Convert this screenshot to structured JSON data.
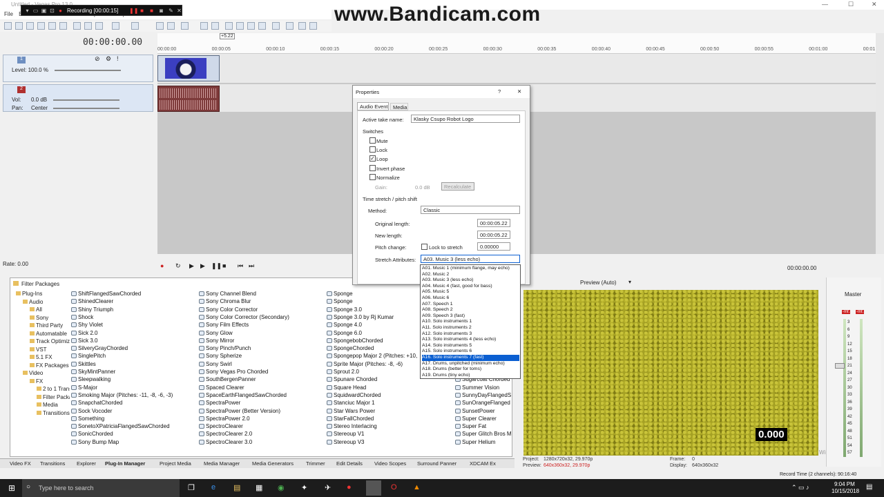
{
  "window": {
    "title": "Untitled - Vegas Pro 13.0",
    "minimize": "—",
    "maximize": "☐",
    "close": "✕"
  },
  "menu": [
    "File",
    "Edit",
    "View",
    "Insert",
    "Tools",
    "Options",
    "Help"
  ],
  "recorder": {
    "status": "Recording [00:00:15]"
  },
  "watermark": "www.Bandicam.com",
  "timeline": {
    "timecode": "00:00:00.00",
    "ruler_marker": "+5.22",
    "ticks": [
      "00:00:00",
      "00:00:05",
      "00:00:10",
      "00:00:15",
      "00:00:20",
      "00:00:25",
      "00:00:30",
      "00:00:35",
      "00:00:40",
      "00:00:45",
      "00:00:50",
      "00:00:55",
      "00:01:00",
      "00:01:05"
    ],
    "rate": "Rate: 0.00",
    "end_time": "00:00:00.00"
  },
  "tracks": {
    "video": {
      "number": "1",
      "level_label": "Level: 100.0 %"
    },
    "audio": {
      "number": "2",
      "vol_label": "Vol:",
      "vol_value": "0.0 dB",
      "pan_label": "Pan:",
      "pan_value": "Center"
    }
  },
  "dialog": {
    "title": "Properties",
    "help": "?",
    "close": "✕",
    "tabs": [
      "Audio Event",
      "Media"
    ],
    "active_take_label": "Active take name:",
    "active_take_value": "Klasky Csupo Robot Logo",
    "switches_label": "Switches",
    "switches": [
      {
        "label": "Mute",
        "checked": false
      },
      {
        "label": "Lock",
        "checked": false
      },
      {
        "label": "Loop",
        "checked": true
      },
      {
        "label": "Invert phase",
        "checked": false
      },
      {
        "label": "Normalize",
        "checked": false
      }
    ],
    "gain_label": "Gain:",
    "gain_value": "0.0 dB",
    "recalc_button": "Recalculate",
    "stretch_section": "Time stretch / pitch shift",
    "method_label": "Method:",
    "method_value": "Classic",
    "original_length_label": "Original length:",
    "original_length_value": "00:00:05.22",
    "new_length_label": "New length:",
    "new_length_value": "00:00:05.22",
    "pitch_change_label": "Pitch change:",
    "lock_to_stretch_label": "Lock to stretch",
    "pitch_value": "0.00000",
    "stretch_attr_label": "Stretch Attributes:",
    "stretch_attr_value": "A03. Music 3 (less echo)",
    "stretch_options": [
      "A01. Music 1 (minimum flange, may echo)",
      "A02. Music 2",
      "A03. Music 3 (less echo)",
      "A04. Music 4 (fast, good for bass)",
      "A05. Music 5",
      "A06. Music 6",
      "A07. Speech 1",
      "A08. Speech 2",
      "A09. Speech 3 (fast)",
      "A10. Solo instruments 1",
      "A11. Solo instruments 2",
      "A12. Solo instruments 3",
      "A13. Solo instruments 4 (less echo)",
      "A14. Solo instruments 5",
      "A15. Solo instruments 6",
      "A16. Solo instruments 7 (fast)",
      "A17. Drums, unpitched (minimum echo)",
      "A18. Drums (better for toms)",
      "A19. Drums (tiny echo)"
    ],
    "highlighted_option": "A16. Solo instruments 7 (fast)"
  },
  "plugin_panel": {
    "header": "Filter Packages",
    "tree": [
      {
        "label": "Plug-Ins",
        "level": 0
      },
      {
        "label": "Audio",
        "level": 1
      },
      {
        "label": "All",
        "level": 2
      },
      {
        "label": "Sony",
        "level": 2
      },
      {
        "label": "Third Party",
        "level": 2
      },
      {
        "label": "Automatable",
        "level": 2
      },
      {
        "label": "Track Optimized",
        "level": 2
      },
      {
        "label": "VST",
        "level": 2
      },
      {
        "label": "5.1 FX",
        "level": 2
      },
      {
        "label": "FX Packages",
        "level": 2
      },
      {
        "label": "Video",
        "level": 1
      },
      {
        "label": "FX",
        "level": 2
      },
      {
        "label": "2 to 1 Transform",
        "level": 3
      },
      {
        "label": "Filter Packages",
        "level": 3
      },
      {
        "label": "Media",
        "level": 3
      },
      {
        "label": "Transitions",
        "level": 3
      }
    ],
    "col1": [
      "ShiftFlangedSawChorded",
      "ShinedClearer",
      "Shiny Triumph",
      "Shock",
      "Shy Violet",
      "Sick 2.0",
      "Sick 3.0",
      "SilveryGrayChorded",
      "SinglePitch",
      "Skittles",
      "SkyMintPanner",
      "Sleepwalking",
      "S-Major",
      "Smoking Major (Pitches: -11, -8, -6, -3)",
      "SnapchatChorded",
      "Sock Vocoder",
      "Something",
      "SonetoXPatriciaFlangedSawChorded",
      "SonicChorded",
      "Sony Bump Map"
    ],
    "col2": [
      "Sony Channel Blend",
      "Sony Chroma Blur",
      "Sony Color Corrector",
      "Sony Color Corrector (Secondary)",
      "Sony Film Effects",
      "Sony Glow",
      "Sony Mirror",
      "Sony Pinch/Punch",
      "Sony Spherize",
      "Sony Swirl",
      "Sony Vegas Pro Chorded",
      "SouthBergenPanner",
      "Spaced Clearer",
      "SpaceEarthFlangedSawChorded",
      "SpectraPower",
      "SpectraPower (Better Version)",
      "SpectraPower 2.0",
      "SpectroClearer",
      "SpectroClearer 2.0",
      "SpectroClearer 3.0"
    ],
    "col3": [
      "Sponge",
      "Sponge",
      "Sponge 3.0",
      "Sponge 3.0 by Rj Kumar",
      "Sponge 4.0",
      "Sponge 6.0",
      "SpongebobChorded",
      "SpongeChorded",
      "Spongepop Major 2 (Pitches: +10,",
      "Sprite Major (Pitches: -8, -6)",
      "Sprout 2.0",
      "Spunare Chorded",
      "Square Head",
      "SquidwardChorded",
      "Stanciuc Major 1",
      "Star Wars Power",
      "StarFallChorded",
      "Stereo Interlacing",
      "Stereoup V1",
      "Stereoup V3"
    ],
    "col4": [
      "Sugarcoat Chorded",
      "Summer Vision",
      "SunnyDayFlangedS",
      "SunOrangeFlanged",
      "SunsetPower",
      "Super Clearer",
      "Super Fat",
      "Super Glitch Bros M",
      "Super Helium"
    ]
  },
  "bottom_tabs": [
    "Video FX",
    "Transitions",
    "Explorer",
    "Plug-In Manager",
    "Project Media",
    "Media Manager",
    "Media Generators",
    "Trimmer",
    "Edit Details",
    "Video Scopes",
    "Surround Panner",
    "XDCAM Ex"
  ],
  "preview": {
    "mode": "Preview (Auto)",
    "time": "0.000",
    "project_label": "Project:",
    "project_value": "1280x720x32, 29.970p",
    "preview_label": "Preview:",
    "preview_value": "640x360x32, 29.970p",
    "frame_label": "Frame:",
    "frame_value": "0",
    "display_label": "Display:",
    "display_value": "640x360x32",
    "activate_hint": "Windows"
  },
  "master": {
    "label": "Master",
    "peak_l": "-Inf.",
    "peak_r": "-Inf.",
    "scale": [
      "3",
      "6",
      "9",
      "12",
      "15",
      "18",
      "21",
      "24",
      "27",
      "30",
      "33",
      "36",
      "39",
      "42",
      "45",
      "48",
      "51",
      "54",
      "57"
    ],
    "level_l": "0.0",
    "level_r": "0.0"
  },
  "record_time": "Record Time (2 channels): 90:16:40",
  "taskbar": {
    "search_placeholder": "Type here to search",
    "time": "9:04 PM",
    "date": "10/15/2018"
  }
}
